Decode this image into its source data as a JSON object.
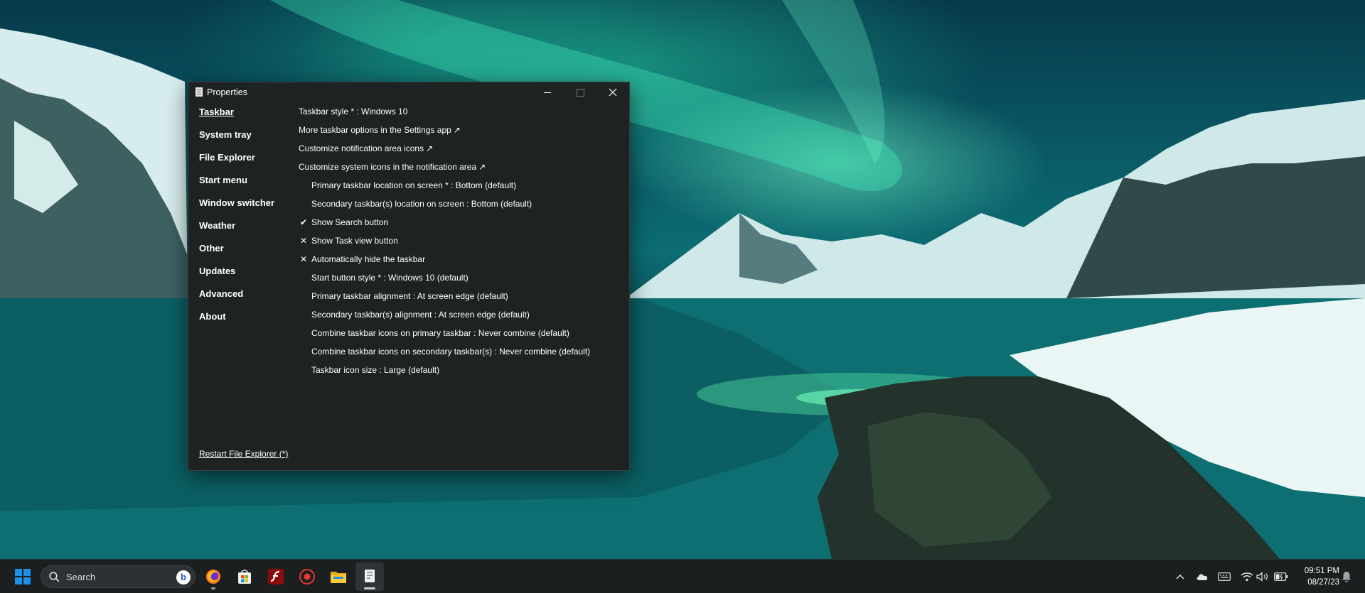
{
  "window": {
    "title": "Properties",
    "minimize_glyph": "—",
    "close_glyph": "✕"
  },
  "sidebar": {
    "items": [
      {
        "label": "Taskbar"
      },
      {
        "label": "System tray"
      },
      {
        "label": "File Explorer"
      },
      {
        "label": "Start menu"
      },
      {
        "label": "Window switcher"
      },
      {
        "label": "Weather"
      },
      {
        "label": "Other"
      },
      {
        "label": "Updates"
      },
      {
        "label": "Advanced"
      },
      {
        "label": "About"
      }
    ],
    "active": "Taskbar",
    "restart_link": "Restart File Explorer (*)"
  },
  "settings": {
    "rows": [
      {
        "label": "Taskbar style * : Windows 10"
      },
      {
        "label": "More taskbar options in the Settings app",
        "ext": "↗"
      },
      {
        "label": "Customize notification area icons",
        "ext": "↗"
      },
      {
        "label": "Customize system icons in the notification area",
        "ext": "↗"
      },
      {
        "label": "Primary taskbar location on screen * : Bottom (default)"
      },
      {
        "label": "Secondary taskbar(s) location on screen : Bottom (default)"
      },
      {
        "label": "Show Search button",
        "mark": "✔"
      },
      {
        "label": "Show Task view button",
        "mark": "✕"
      },
      {
        "label": "Automatically hide the taskbar",
        "mark": "✕"
      },
      {
        "label": "Start button style * : Windows 10 (default)"
      },
      {
        "label": "Primary taskbar alignment : At screen edge (default)"
      },
      {
        "label": "Secondary taskbar(s) alignment : At screen edge (default)"
      },
      {
        "label": "Combine taskbar icons on primary taskbar : Never combine (default)"
      },
      {
        "label": "Combine taskbar icons on secondary taskbar(s) : Never combine (default)"
      },
      {
        "label": "Taskbar icon size : Large (default)"
      }
    ]
  },
  "taskbar": {
    "search_placeholder": "Search",
    "bing_letter": "b",
    "apps": [
      "start-icon",
      "firefox-icon",
      "store-icon",
      "flash-icon",
      "record-icon",
      "file-explorer-icon",
      "properties-app-icon"
    ],
    "clock_time": "09:51 PM",
    "clock_date": "08/27/23"
  },
  "colors": {
    "window_bg": "#1f2223",
    "taskbar_bg": "#1b1f20",
    "accent_windows_blue": "#1e90e8"
  }
}
